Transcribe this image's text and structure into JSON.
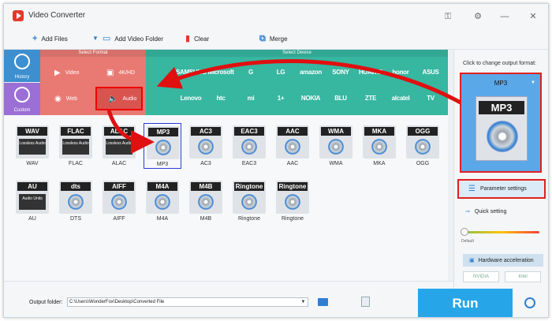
{
  "app": {
    "title": "Video Converter"
  },
  "colors": {
    "accent": "#26a6e8",
    "format_panel": "#e87a73",
    "device_panel": "#37b6a0",
    "highlight": "#e02020"
  },
  "toolbar": {
    "add_files": "Add Files",
    "add_video_folder": "Add Video Folder",
    "clear": "Clear",
    "merge": "Merge"
  },
  "sidebar": {
    "history": "History",
    "custom": "Custom"
  },
  "format_panel": {
    "header": "Select Format",
    "buttons": {
      "video": "Video",
      "hd": "4K/HD",
      "web": "Web",
      "audio": "Audio"
    }
  },
  "device_panel": {
    "header": "Select Device",
    "brands": [
      "",
      "SAMSUNG",
      "Microsoft",
      "G",
      "LG",
      "amazon",
      "SONY",
      "HUAWEI",
      "honor",
      "ASUS",
      "",
      "Lenovo",
      "htc",
      "mi",
      "1+",
      "NOKIA",
      "BLU",
      "ZTE",
      "alcatel",
      "TV"
    ]
  },
  "formats": [
    {
      "label": "WAV",
      "name": "WAV",
      "sub": "Lossless Audio"
    },
    {
      "label": "FLAC",
      "name": "FLAC",
      "sub": "Lossless Audio"
    },
    {
      "label": "ALAC",
      "name": "ALAC",
      "sub": "Lossless Audio"
    },
    {
      "label": "MP3",
      "name": "MP3",
      "sub": ""
    },
    {
      "label": "AC3",
      "name": "AC3",
      "sub": ""
    },
    {
      "label": "EAC3",
      "name": "EAC3",
      "sub": ""
    },
    {
      "label": "AAC",
      "name": "AAC",
      "sub": ""
    },
    {
      "label": "WMA",
      "name": "WMA",
      "sub": ""
    },
    {
      "label": "MKA",
      "name": "MKA",
      "sub": ""
    },
    {
      "label": "OGG",
      "name": "OGG",
      "sub": ""
    },
    {
      "label": "AU",
      "name": "AU",
      "sub": "Audio Units"
    },
    {
      "label": "dts",
      "name": "DTS",
      "sub": ""
    },
    {
      "label": "AIFF",
      "name": "AIFF",
      "sub": ""
    },
    {
      "label": "M4A",
      "name": "M4A",
      "sub": ""
    },
    {
      "label": "M4B",
      "name": "M4B",
      "sub": ""
    },
    {
      "label": "Ringtone",
      "name": "Ringtone",
      "sub": ""
    },
    {
      "label": "Ringtone",
      "name": "Ringtone",
      "sub": ""
    }
  ],
  "selected_format": "MP3",
  "right_panel": {
    "hint": "Click to change output format:",
    "output_format": "MP3",
    "parameter_settings": "Parameter settings",
    "quick_setting": "Quick setting",
    "default_label": "Default",
    "hardware_acceleration": "Hardware acceleration",
    "nvidia": "NVIDIA",
    "intel": "Intel"
  },
  "bottom": {
    "output_folder_label": "Output folder:",
    "output_folder_path": "C:\\Users\\WonderFox\\Desktop\\Converted File",
    "run": "Run"
  }
}
